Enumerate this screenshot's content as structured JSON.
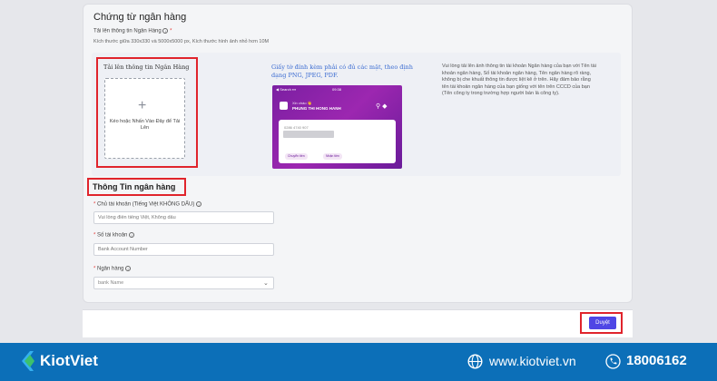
{
  "form": {
    "section_title": "Chứng từ ngân hàng",
    "upload_label": "Tải lên thông tin Ngân Hàng",
    "required_mark": "*",
    "info_icon": "info-icon",
    "size_note": "Kích thước giữa 330x330 và 5000x5000 px,  Kích thước hình ảnh nhỏ hơn 10M",
    "upload_box_title": "Tải lên thông tin Ngân Hàng",
    "dropzone_plus": "+",
    "dropzone_text": "Kéo hoặc Nhấn Vào Đây để Tải Lên",
    "sample_note": "Giấy tờ đính kèm phải có đủ các mặt, theo định dạng PNG, JPEG, PDF.",
    "guide_text": "Vui lòng tải lên ảnh thông tin tài khoản Ngân hàng của bạn với Tên tài khoản ngân hàng, Số tài khoản ngân hàng, Tên ngân hàng rõ ràng, không bị che khuất thông tin được liệt kê ở trên. Hãy đảm bảo rằng tên tài khoản ngân hàng của bạn giống với tên trên CCCD của bạn (Tên công ty trong trường hợp người bán là công ty)."
  },
  "sample_phone": {
    "status": "◀ Search ▪▪▪",
    "time": "09:38",
    "hello": "Xin chào 👋",
    "name": "PHUNG THI HONG HANH",
    "account": "0286 4740 907",
    "chip_transfer": "Chuyển tiền",
    "chip_receive": "Nhận tiền"
  },
  "bank_info": {
    "title": "Thông Tin ngân hàng",
    "holder_label": "Chủ tài khoản (Tiếng Việt KHÔNG DẤU)",
    "holder_placeholder": "Vui lòng điền tiếng Việt, Không dấu",
    "account_label": "Số tài khoản",
    "account_placeholder": "Bank Account Number",
    "bank_label": "Ngân hàng",
    "bank_placeholder": "bank Name"
  },
  "actions": {
    "approve_label": "Duyệt"
  },
  "footer": {
    "brand": "KiotViet",
    "website": "www.kiotviet.vn",
    "hotline": "18006162"
  },
  "colors": {
    "accent_button": "#4f46e5",
    "highlight_red": "#e0242c",
    "footer_blue": "#0c6fb8",
    "link_blue": "#3a6bd1"
  }
}
